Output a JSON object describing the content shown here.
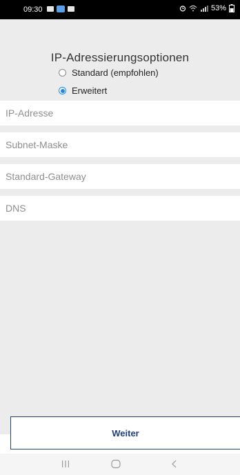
{
  "status_bar": {
    "time": "09:30",
    "battery": "53%"
  },
  "screen": {
    "title": "IP-Adressierungsoptionen",
    "options": [
      {
        "label": "Standard (empfohlen)",
        "selected": false
      },
      {
        "label": "Erweitert",
        "selected": true
      }
    ],
    "fields": [
      {
        "placeholder": "IP-Adresse"
      },
      {
        "placeholder": "Subnet-Maske"
      },
      {
        "placeholder": "Standard-Gateway"
      },
      {
        "placeholder": "DNS"
      }
    ],
    "continue_label": "Weiter"
  },
  "nav_bar": {
    "recent_icon": "recent-apps-icon",
    "home_icon": "home-icon",
    "back_icon": "back-icon"
  },
  "colors": {
    "accent": "#1e88e5",
    "button_text": "#1f3f7a",
    "background": "#ececec"
  }
}
